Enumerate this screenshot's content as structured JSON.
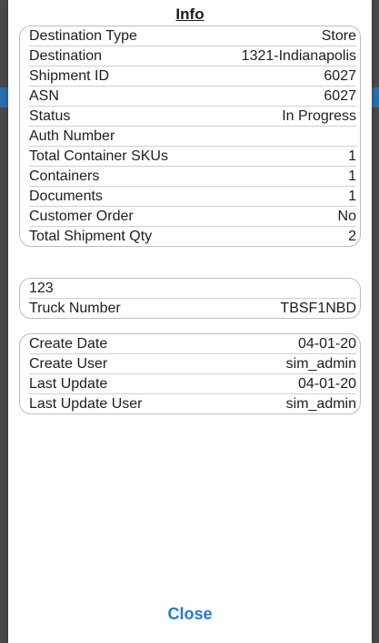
{
  "dialog": {
    "title": "Info",
    "close_label": "Close"
  },
  "shipment_details": [
    {
      "label": "Destination Type",
      "value": "Store"
    },
    {
      "label": "Destination",
      "value": "1321-Indianapolis"
    },
    {
      "label": "Shipment ID",
      "value": "6027"
    },
    {
      "label": "ASN",
      "value": "6027"
    },
    {
      "label": "Status",
      "value": "In Progress"
    },
    {
      "label": "Auth Number",
      "value": ""
    },
    {
      "label": "Total Container SKUs",
      "value": "1"
    },
    {
      "label": "Containers",
      "value": "1"
    },
    {
      "label": "Documents",
      "value": "1"
    },
    {
      "label": "Customer Order",
      "value": "No"
    },
    {
      "label": "Total Shipment Qty",
      "value": "2"
    }
  ],
  "transport_details": [
    {
      "label": "123",
      "value": ""
    },
    {
      "label": "Truck Number",
      "value": "TBSF1NBD"
    }
  ],
  "audit_details": [
    {
      "label": "Create Date",
      "value": "04-01-20"
    },
    {
      "label": "Create User",
      "value": "sim_admin"
    },
    {
      "label": "Last Update",
      "value": "04-01-20"
    },
    {
      "label": "Last Update User",
      "value": "sim_admin"
    }
  ],
  "colors": {
    "accent": "#1f7bd6",
    "border": "#bdbdbd"
  }
}
